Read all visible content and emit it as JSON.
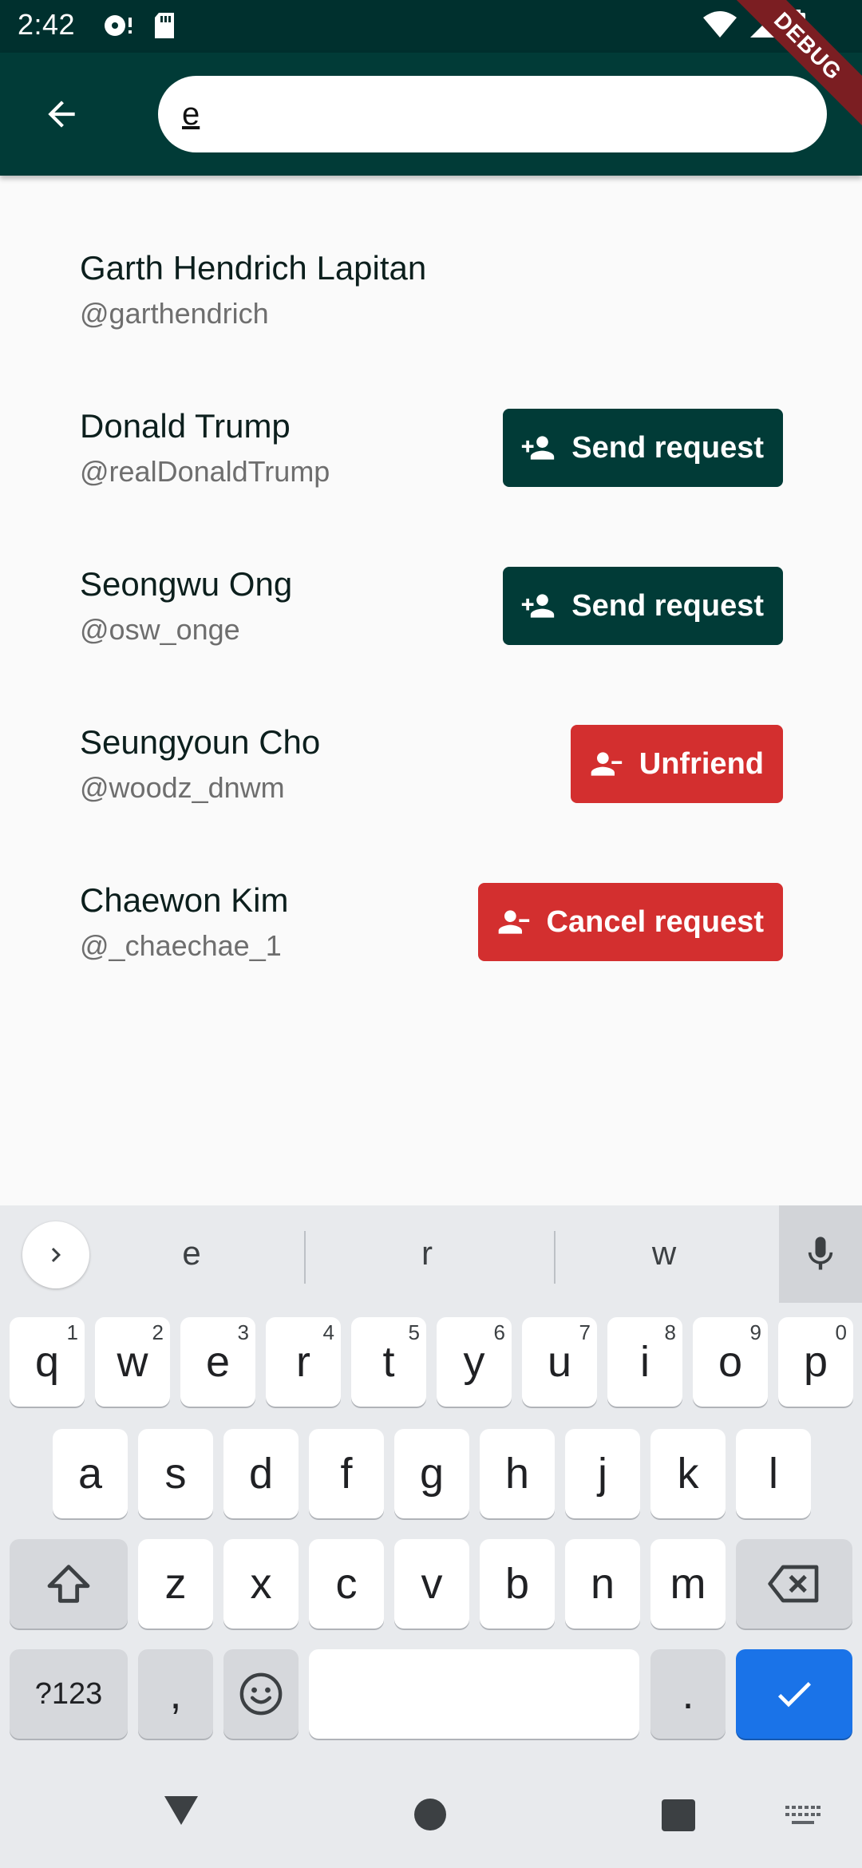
{
  "status_bar": {
    "time": "2:42"
  },
  "debug_label": "DEBUG",
  "search": {
    "value": "e",
    "placeholder": ""
  },
  "results": [
    {
      "name": "Garth Hendrich Lapitan",
      "handle": "@garthendrich",
      "action": null
    },
    {
      "name": "Donald Trump",
      "handle": "@realDonaldTrump",
      "action": {
        "label": "Send request",
        "style": "green",
        "icon": "person-add-icon"
      }
    },
    {
      "name": "Seongwu Ong",
      "handle": "@osw_onge",
      "action": {
        "label": "Send request",
        "style": "green",
        "icon": "person-add-icon"
      }
    },
    {
      "name": "Seungyoun Cho",
      "handle": "@woodz_dnwm",
      "action": {
        "label": "Unfriend",
        "style": "red",
        "icon": "person-remove-icon"
      }
    },
    {
      "name": "Chaewon Kim",
      "handle": "@_chaechae_1",
      "action": {
        "label": "Cancel request",
        "style": "red",
        "icon": "person-remove-icon"
      }
    }
  ],
  "keyboard": {
    "suggestions": [
      "e",
      "r",
      "w"
    ],
    "row1": [
      {
        "key": "q",
        "hint": "1"
      },
      {
        "key": "w",
        "hint": "2"
      },
      {
        "key": "e",
        "hint": "3"
      },
      {
        "key": "r",
        "hint": "4"
      },
      {
        "key": "t",
        "hint": "5"
      },
      {
        "key": "y",
        "hint": "6"
      },
      {
        "key": "u",
        "hint": "7"
      },
      {
        "key": "i",
        "hint": "8"
      },
      {
        "key": "o",
        "hint": "9"
      },
      {
        "key": "p",
        "hint": "0"
      }
    ],
    "row2": [
      "a",
      "s",
      "d",
      "f",
      "g",
      "h",
      "j",
      "k",
      "l"
    ],
    "row3": [
      "z",
      "x",
      "c",
      "v",
      "b",
      "n",
      "m"
    ],
    "symbols_label": "?123",
    "comma_label": ",",
    "period_label": "."
  },
  "colors": {
    "app_bar": "#013b37",
    "status_bar": "#00302e",
    "button_green": "#013b37",
    "button_red": "#d32f2f",
    "keyboard_accent": "#1a73e8"
  }
}
